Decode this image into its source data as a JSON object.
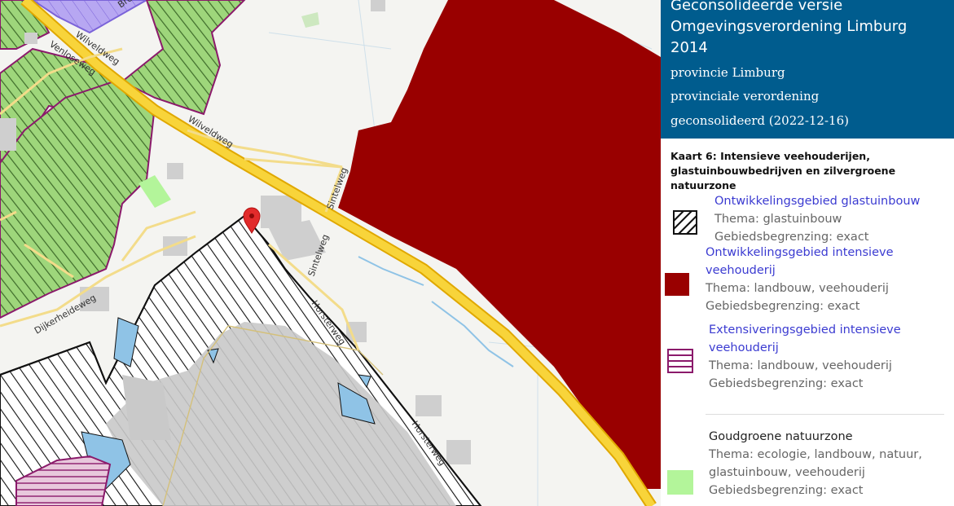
{
  "panel": {
    "title": "Geconsolideerde versie Omgevingsverordening Limburg 2014",
    "publisher": "provincie Limburg",
    "doc_type": "provinciale verordening",
    "status": "geconsolideerd (2022-12-16)",
    "map_title": "Kaart 6: Intensieve veehouderijen, glastuinbouwbedrijven en zilvergroene natuurzone"
  },
  "legend": [
    {
      "name": "Ontwikkelingsgebied glastuinbouw",
      "thema": "Thema: glastuinbouw",
      "begrenzing": "Gebiedsbegrenzing: exact",
      "swatch": "black-diagonal-hatch",
      "link": true
    },
    {
      "name": "Ontwikkelingsgebied intensieve veehouderij",
      "thema": "Thema: landbouw, veehouderij",
      "begrenzing": "Gebiedsbegrenzing: exact",
      "swatch": "dark-red-fill",
      "color": "#990000",
      "link": true
    },
    {
      "name": "Extensiveringsgebied intensieve veehouderij",
      "thema": "Thema: landbouw, veehouderij",
      "begrenzing": "Gebiedsbegrenzing: exact",
      "swatch": "purple-horizontal-hatch",
      "color": "#8b1a6b",
      "link": true
    },
    {
      "name": "Goudgroene natuurzone",
      "thema": "Thema: ecologie, landbouw, natuur, glastuinbouw, veehouderij",
      "begrenzing": "Gebiedsbegrenzing: exact",
      "swatch": "light-green-fill",
      "color": "#b3f59a",
      "link": false
    }
  ],
  "map": {
    "road_labels": [
      "Wilveldweg",
      "Venloseweg",
      "Wilveldweg",
      "Sintelweg",
      "Sintelweg",
      "Horsterweg",
      "Horsterweg",
      "Dijkerheideweg",
      "Bre"
    ],
    "marker": "map-pin-icon",
    "colors": {
      "highway": "#f5c400",
      "header_bg": "#005c8e",
      "intensive": "#990000",
      "extensivering": "#8b1a6b",
      "goudgroen": "#b3f59a"
    }
  }
}
